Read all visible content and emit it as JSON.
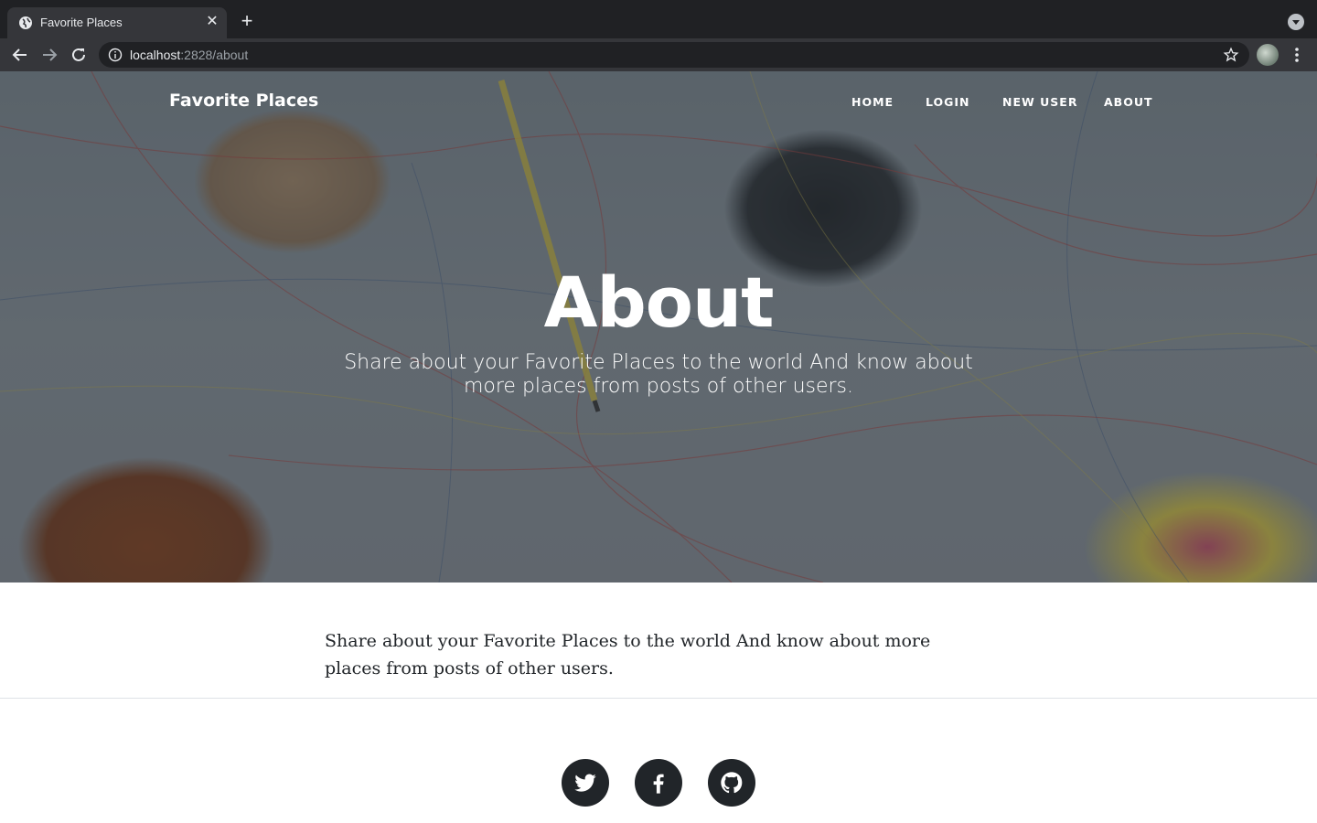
{
  "browser": {
    "tab_title": "Favorite Places",
    "url_host": "localhost",
    "url_path": ":2828/about"
  },
  "site": {
    "brand": "Favorite Places",
    "nav": [
      "HOME",
      "LOGIN",
      "NEW USER",
      "ABOUT"
    ]
  },
  "hero": {
    "title": "About",
    "subtitle": "Share about your Favorite Places to the world And know about more places from posts of other users."
  },
  "content": {
    "paragraph": "Share about your Favorite Places to the world And know about more places from posts of other users."
  },
  "footer": {
    "social_icons": [
      "twitter-icon",
      "facebook-icon",
      "github-icon"
    ]
  },
  "colors": {
    "chrome_dark": "#202124",
    "chrome_toolbar": "#35363a",
    "social_bg": "#212529",
    "text_dark": "#212529"
  }
}
